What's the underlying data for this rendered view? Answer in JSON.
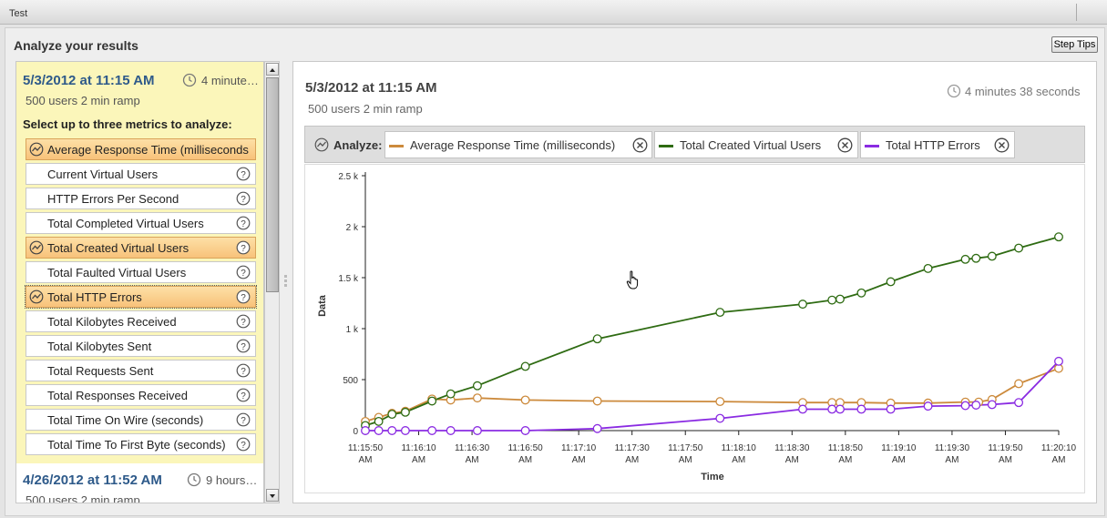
{
  "app": {
    "tab_title": "Test"
  },
  "page": {
    "title": "Analyze your results",
    "step_tips_label": "Step Tips"
  },
  "runs": [
    {
      "date": "5/3/2012 at 11:15 AM",
      "duration": "4 minute…",
      "description": "500 users 2 min ramp",
      "prompt": "Select up to three metrics to analyze:",
      "metrics": [
        {
          "label": "Average Response Time (milliseconds",
          "selected": true
        },
        {
          "label": "Current Virtual Users",
          "selected": false
        },
        {
          "label": "HTTP Errors Per Second",
          "selected": false
        },
        {
          "label": "Total Completed Virtual Users",
          "selected": false
        },
        {
          "label": "Total Created Virtual Users",
          "selected": true
        },
        {
          "label": "Total Faulted Virtual Users",
          "selected": false
        },
        {
          "label": "Total HTTP Errors",
          "selected": true
        },
        {
          "label": "Total Kilobytes Received",
          "selected": false
        },
        {
          "label": "Total Kilobytes Sent",
          "selected": false
        },
        {
          "label": "Total Requests Sent",
          "selected": false
        },
        {
          "label": "Total Responses Received",
          "selected": false
        },
        {
          "label": "Total Time On Wire (seconds)",
          "selected": false
        },
        {
          "label": "Total Time To First Byte (seconds)",
          "selected": false
        }
      ]
    },
    {
      "date": "4/26/2012 at 11:52 AM",
      "duration": "9 hours…",
      "description": "500 users 2 min ramp"
    }
  ],
  "detail": {
    "date": "5/3/2012 at 11:15 AM",
    "description": "500 users 2 min ramp",
    "duration": "4 minutes 38 seconds",
    "analyze_label": "Analyze:",
    "chips": [
      {
        "label": "Average Response Time (milliseconds)",
        "color": "#cc8a3c"
      },
      {
        "label": "Total Created Virtual Users",
        "color": "#2e6b12"
      },
      {
        "label": "Total HTTP Errors",
        "color": "#8a2be2"
      }
    ]
  },
  "icons": {
    "clock": "clock-icon",
    "trend": "line-chart-icon",
    "help": "help-icon",
    "remove": "close-circle-icon",
    "cursor": "hand-cursor-icon",
    "splitter": "grip-icon"
  },
  "chart_data": {
    "type": "line",
    "xlabel": "Time",
    "ylabel": "Data",
    "ylim": [
      0,
      2500
    ],
    "yticks": [
      0,
      500,
      1000,
      1500,
      2000,
      2500
    ],
    "ytick_labels": [
      "0",
      "500",
      "1 k",
      "1.5 k",
      "2 k",
      "2.5 k"
    ],
    "xlim": [
      "11:15:50",
      "11:20:10"
    ],
    "xtick_labels": [
      [
        "11:15:50",
        "AM"
      ],
      [
        "11:16:10",
        "AM"
      ],
      [
        "11:16:30",
        "AM"
      ],
      [
        "11:16:50",
        "AM"
      ],
      [
        "11:17:10",
        "AM"
      ],
      [
        "11:17:30",
        "AM"
      ],
      [
        "11:17:50",
        "AM"
      ],
      [
        "11:18:10",
        "AM"
      ],
      [
        "11:18:30",
        "AM"
      ],
      [
        "11:18:50",
        "AM"
      ],
      [
        "11:19:10",
        "AM"
      ],
      [
        "11:19:30",
        "AM"
      ],
      [
        "11:19:50",
        "AM"
      ],
      [
        "11:20:10",
        "AM"
      ]
    ],
    "grid": false,
    "series": [
      {
        "name": "Average Response Time (milliseconds)",
        "color": "#cc8a3c",
        "points": [
          [
            "11:15:50",
            90
          ],
          [
            "11:15:55",
            130
          ],
          [
            "11:16:00",
            170
          ],
          [
            "11:16:05",
            190
          ],
          [
            "11:16:15",
            310
          ],
          [
            "11:16:22",
            300
          ],
          [
            "11:16:32",
            320
          ],
          [
            "11:16:50",
            300
          ],
          [
            "11:17:17",
            290
          ],
          [
            "11:18:03",
            285
          ],
          [
            "11:18:34",
            275
          ],
          [
            "11:18:45",
            275
          ],
          [
            "11:18:48",
            275
          ],
          [
            "11:18:56",
            275
          ],
          [
            "11:19:07",
            270
          ],
          [
            "11:19:21",
            270
          ],
          [
            "11:19:35",
            280
          ],
          [
            "11:19:40",
            280
          ],
          [
            "11:19:45",
            305
          ],
          [
            "11:19:55",
            460
          ],
          [
            "11:20:10",
            610
          ]
        ]
      },
      {
        "name": "Total Created Virtual Users",
        "color": "#2e6b12",
        "points": [
          [
            "11:15:50",
            50
          ],
          [
            "11:15:55",
            90
          ],
          [
            "11:16:00",
            160
          ],
          [
            "11:16:05",
            180
          ],
          [
            "11:16:15",
            290
          ],
          [
            "11:16:22",
            360
          ],
          [
            "11:16:32",
            440
          ],
          [
            "11:16:50",
            630
          ],
          [
            "11:17:17",
            900
          ],
          [
            "11:18:03",
            1160
          ],
          [
            "11:18:34",
            1240
          ],
          [
            "11:18:45",
            1280
          ],
          [
            "11:18:48",
            1290
          ],
          [
            "11:18:56",
            1350
          ],
          [
            "11:19:07",
            1460
          ],
          [
            "11:19:21",
            1590
          ],
          [
            "11:19:35",
            1680
          ],
          [
            "11:19:39",
            1690
          ],
          [
            "11:19:45",
            1710
          ],
          [
            "11:19:55",
            1790
          ],
          [
            "11:20:10",
            1900
          ]
        ]
      },
      {
        "name": "Total HTTP Errors",
        "color": "#8a2be2",
        "points": [
          [
            "11:15:50",
            0
          ],
          [
            "11:15:55",
            0
          ],
          [
            "11:16:00",
            0
          ],
          [
            "11:16:05",
            0
          ],
          [
            "11:16:15",
            0
          ],
          [
            "11:16:22",
            0
          ],
          [
            "11:16:32",
            0
          ],
          [
            "11:16:50",
            0
          ],
          [
            "11:17:17",
            20
          ],
          [
            "11:18:03",
            120
          ],
          [
            "11:18:34",
            210
          ],
          [
            "11:18:45",
            210
          ],
          [
            "11:18:48",
            210
          ],
          [
            "11:18:56",
            210
          ],
          [
            "11:19:07",
            210
          ],
          [
            "11:19:21",
            240
          ],
          [
            "11:19:35",
            245
          ],
          [
            "11:19:39",
            250
          ],
          [
            "11:19:45",
            255
          ],
          [
            "11:19:55",
            275
          ],
          [
            "11:20:10",
            680
          ]
        ]
      }
    ]
  }
}
